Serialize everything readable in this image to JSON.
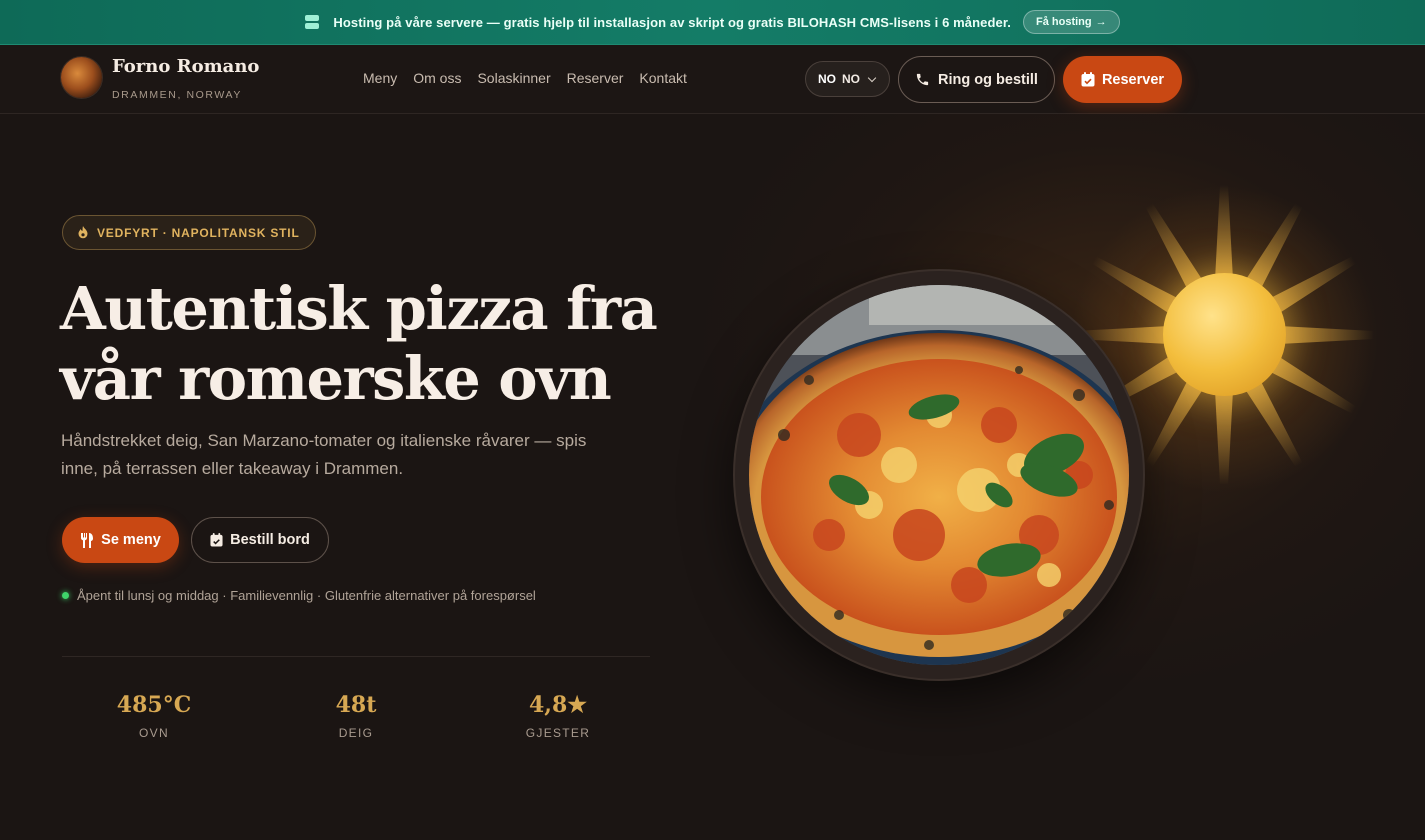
{
  "promo": {
    "text": "Hosting på våre servere — gratis hjelp til installasjon av skript og gratis BILOHASH CMS-lisens i 6 måneder.",
    "button_label": "Få hosting",
    "button_arrow": "→"
  },
  "brand": {
    "name": "Forno Romano",
    "location": "DRAMMEN, NORWAY"
  },
  "nav": {
    "links": [
      "Meny",
      "Om oss",
      "Solaskinner",
      "Reserver",
      "Kontakt"
    ]
  },
  "lang": {
    "flag_text": "NO",
    "code": "NO"
  },
  "actions": {
    "call_label": "Ring og bestill",
    "reserve_label": "Reserver"
  },
  "hero": {
    "badge": "VEDFYRT · NAPOLITANSK STIL",
    "headline_line1": "Autentisk pizza fra",
    "headline_line2": "vår romerske ovn",
    "lead": "Håndstrekket deig, San Marzano-tomater og italienske råvarer — spis inne, på terrassen eller takeaway i Drammen.",
    "menu_button": "Se meny",
    "book_button": "Bestill bord",
    "status": "Åpent til lunsj og middag · Familievennlig · Glutenfrie alternativer på forespørsel"
  },
  "stats": [
    {
      "value": "485°C",
      "label": "OVN"
    },
    {
      "value": "48t",
      "label": "DEIG"
    },
    {
      "value": "4,8★",
      "label": "GJESTER"
    }
  ],
  "colors": {
    "background": "#1b1513",
    "accent": "#c94813",
    "gold": "#d7a853",
    "promo": "#0e6a57"
  }
}
